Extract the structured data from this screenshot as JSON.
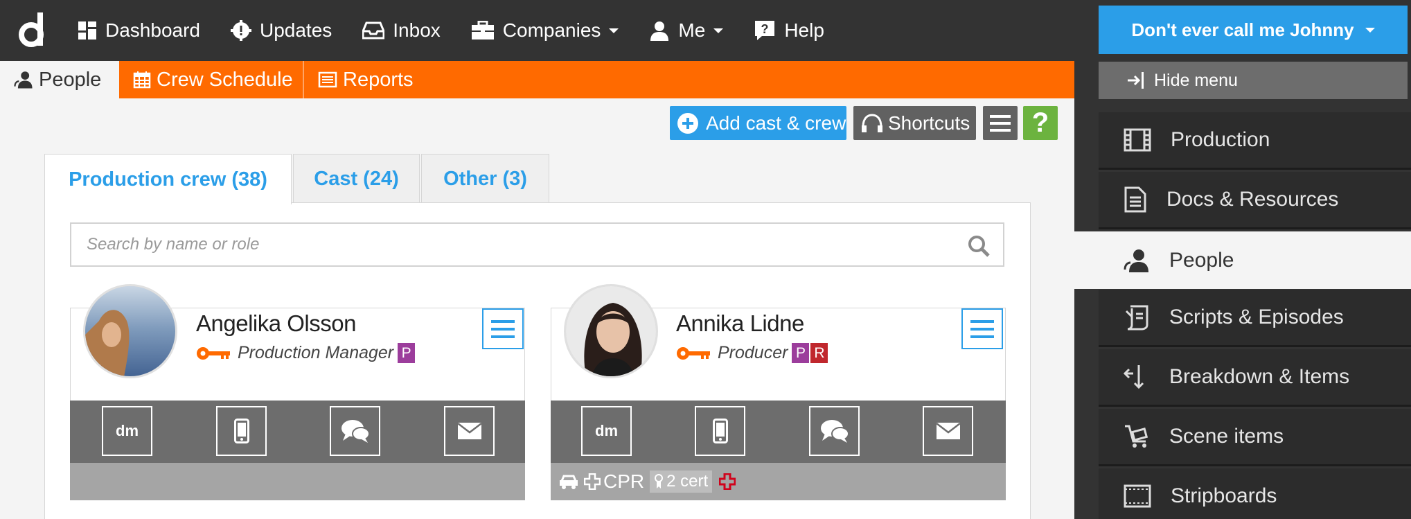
{
  "topnav": {
    "logo": "d",
    "items": [
      {
        "label": "Dashboard",
        "icon": "dashboard-icon"
      },
      {
        "label": "Updates",
        "icon": "gear-badge-icon"
      },
      {
        "label": "Inbox",
        "icon": "inbox-icon"
      },
      {
        "label": "Companies",
        "icon": "briefcase-icon",
        "dropdown": true
      },
      {
        "label": "Me",
        "icon": "user-icon",
        "dropdown": true
      },
      {
        "label": "Help",
        "icon": "help-icon"
      }
    ]
  },
  "sidebar": {
    "user_label": "Don't ever call me Johnny",
    "hide_menu": "Hide menu",
    "items": [
      {
        "label": "Production",
        "icon": "film-icon"
      },
      {
        "label": "Docs & Resources",
        "icon": "document-icon"
      },
      {
        "label": "People",
        "icon": "people-icon",
        "active": true
      },
      {
        "label": "Scripts & Episodes",
        "icon": "script-icon"
      },
      {
        "label": "Breakdown & Items",
        "icon": "breakdown-icon"
      },
      {
        "label": "Scene items",
        "icon": "cart-icon"
      },
      {
        "label": "Stripboards",
        "icon": "stripboard-icon"
      }
    ]
  },
  "tabs": [
    {
      "label": "People",
      "icon": "people-icon",
      "active": true
    },
    {
      "label": "Crew Schedule",
      "icon": "calendar-icon"
    },
    {
      "label": "Reports",
      "icon": "report-icon"
    }
  ],
  "actions": {
    "add_label": "Add cast & crew",
    "shortcuts_label": "Shortcuts",
    "help_label": "?"
  },
  "people_tabs": [
    {
      "label": "Production crew (38)",
      "active": true
    },
    {
      "label": "Cast (24)"
    },
    {
      "label": "Other (3)"
    }
  ],
  "search": {
    "placeholder": "Search by name or role"
  },
  "cards": [
    {
      "name": "Angelika Olsson",
      "role": "Production Manager",
      "badges": [
        "P"
      ],
      "actions": [
        "dm",
        "phone-icon",
        "chat-icon",
        "mail-icon"
      ]
    },
    {
      "name": "Annika Lidne",
      "role": "Producer",
      "badges": [
        "P",
        "R"
      ],
      "actions": [
        "dm",
        "phone-icon",
        "chat-icon",
        "mail-icon"
      ],
      "info": {
        "cpr": "CPR",
        "cert": "2 cert"
      }
    }
  ],
  "colors": {
    "dark": "#333333",
    "orange": "#ff6a00",
    "blue": "#2b9ee8",
    "green": "#6cb33f",
    "purple": "#9c3d9c",
    "red": "#c0272d"
  }
}
